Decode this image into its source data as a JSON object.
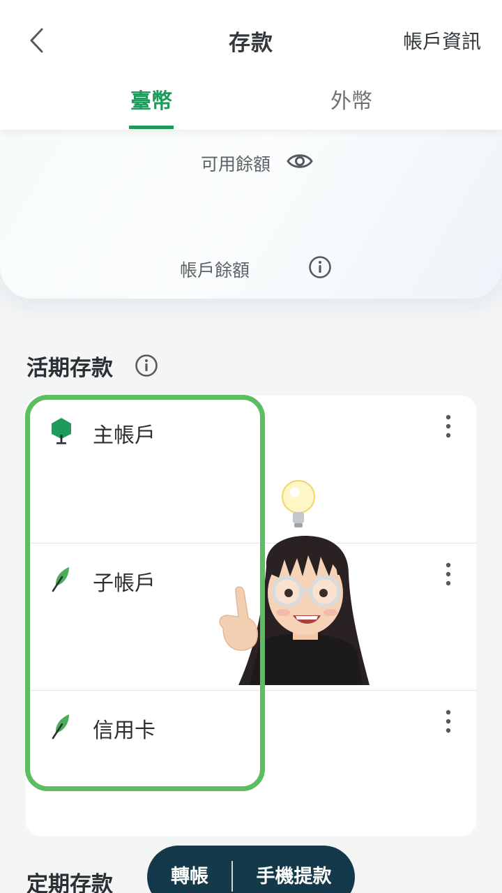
{
  "header": {
    "title": "存款",
    "account_info": "帳戶資訊",
    "tabs": [
      {
        "label": "臺幣",
        "active": true
      },
      {
        "label": "外幣",
        "active": false
      }
    ]
  },
  "balance": {
    "available_label": "可用餘額",
    "account_balance_label": "帳戶餘額"
  },
  "demand_deposit": {
    "title": "活期存款",
    "accounts": [
      {
        "name": "主帳戶",
        "icon": "tree-icon"
      },
      {
        "name": "子帳戶",
        "icon": "leaf-icon"
      },
      {
        "name": "信用卡",
        "icon": "leaf-icon"
      }
    ]
  },
  "time_deposit": {
    "title": "定期存款"
  },
  "actions": {
    "transfer": "轉帳",
    "withdraw": "手機提款"
  },
  "colors": {
    "accent": "#1e9a5c",
    "highlight": "#5cbd61",
    "action_bar": "#14394a"
  }
}
